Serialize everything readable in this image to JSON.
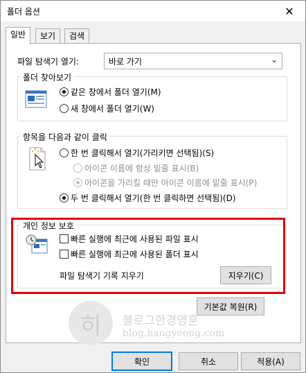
{
  "window": {
    "title": "폴더 옵션",
    "close_glyph": "✕"
  },
  "tabs": [
    {
      "label": "일반",
      "active": true
    },
    {
      "label": "보기"
    },
    {
      "label": "검색"
    }
  ],
  "explorer_open": {
    "label": "파일 탐색기 열기:",
    "value": "바로 가기"
  },
  "browse_folders": {
    "title": "폴더 찾아보기",
    "options": [
      {
        "label": "같은 창에서 폴더 열기(M)",
        "checked": true
      },
      {
        "label": "새 창에서 폴더 열기(W)",
        "checked": false
      }
    ]
  },
  "click_items": {
    "title": "항목을 다음과 같이 클릭",
    "options": [
      {
        "label": "한 번 클릭해서 열기(가리키면 선택됨)(S)",
        "checked": false
      },
      {
        "label": "아이콘 이름에 항상 밑줄 표시(B)",
        "checked": false,
        "disabled": true
      },
      {
        "label": "아이콘을 가리킬 때만 아이콘 이름에 밑줄 표시(P)",
        "checked": true,
        "disabled": true
      },
      {
        "label": "두 번 클릭해서 열기(한 번 클릭하면 선택됨)(D)",
        "checked": true
      }
    ]
  },
  "privacy": {
    "title": "개인 정보 보호",
    "options": [
      {
        "label": "빠른 실행에 최근에 사용된 파일 표시",
        "checked": false
      },
      {
        "label": "빠른 실행에 최근에 사용된 폴더 표시",
        "checked": false
      }
    ],
    "clear_label": "파일 탐색기 기록 지우기",
    "clear_button": "지우기(C)"
  },
  "restore_defaults": "기본값 복원(R)",
  "watermark": {
    "glyph": "히",
    "text1": "블로그한경영훈",
    "text2": "blog.hangyeong.com"
  },
  "footer": {
    "ok": "확인",
    "cancel": "취소",
    "apply": "적용(A)"
  },
  "colors": {
    "highlight": "#e50000",
    "primary_border": "#0078d7"
  }
}
